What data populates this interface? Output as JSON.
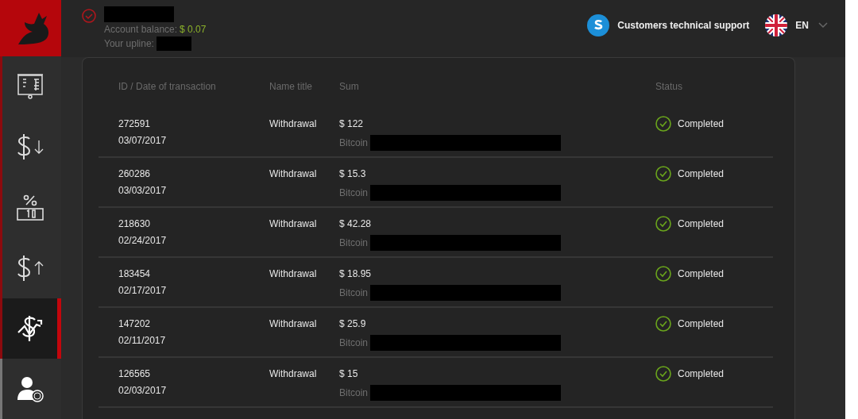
{
  "header": {
    "account_label": "Account balance:",
    "balance": "$ 0.07",
    "upline_label": "Your upline:",
    "support": "Customers technical support",
    "language": "EN"
  },
  "sidebar": {
    "items": [
      {
        "kind": "presentation",
        "selected": false
      },
      {
        "kind": "dollar-down",
        "selected": false
      },
      {
        "kind": "percent",
        "selected": false
      },
      {
        "kind": "dollar-up",
        "selected": false
      },
      {
        "kind": "exchange",
        "selected": true
      },
      {
        "kind": "partner",
        "selected": false
      }
    ]
  },
  "table": {
    "columns": [
      "ID / Date of transaction",
      "Name title",
      "Sum",
      "Status"
    ],
    "rows": [
      {
        "id": "272591",
        "date": "03/07/2017",
        "name": "Withdrawal",
        "sum": "$ 122",
        "method": "Bitcoin",
        "status": "Completed"
      },
      {
        "id": "260286",
        "date": "03/03/2017",
        "name": "Withdrawal",
        "sum": "$ 15.3",
        "method": "Bitcoin",
        "status": "Completed"
      },
      {
        "id": "218630",
        "date": "02/24/2017",
        "name": "Withdrawal",
        "sum": "$ 42.28",
        "method": "Bitcoin",
        "status": "Completed"
      },
      {
        "id": "183454",
        "date": "02/17/2017",
        "name": "Withdrawal",
        "sum": "$ 18.95",
        "method": "Bitcoin",
        "status": "Completed"
      },
      {
        "id": "147202",
        "date": "02/11/2017",
        "name": "Withdrawal",
        "sum": "$ 25.9",
        "method": "Bitcoin",
        "status": "Completed"
      },
      {
        "id": "126565",
        "date": "02/03/2017",
        "name": "Withdrawal",
        "sum": "$ 15",
        "method": "Bitcoin",
        "status": "Completed"
      }
    ]
  }
}
